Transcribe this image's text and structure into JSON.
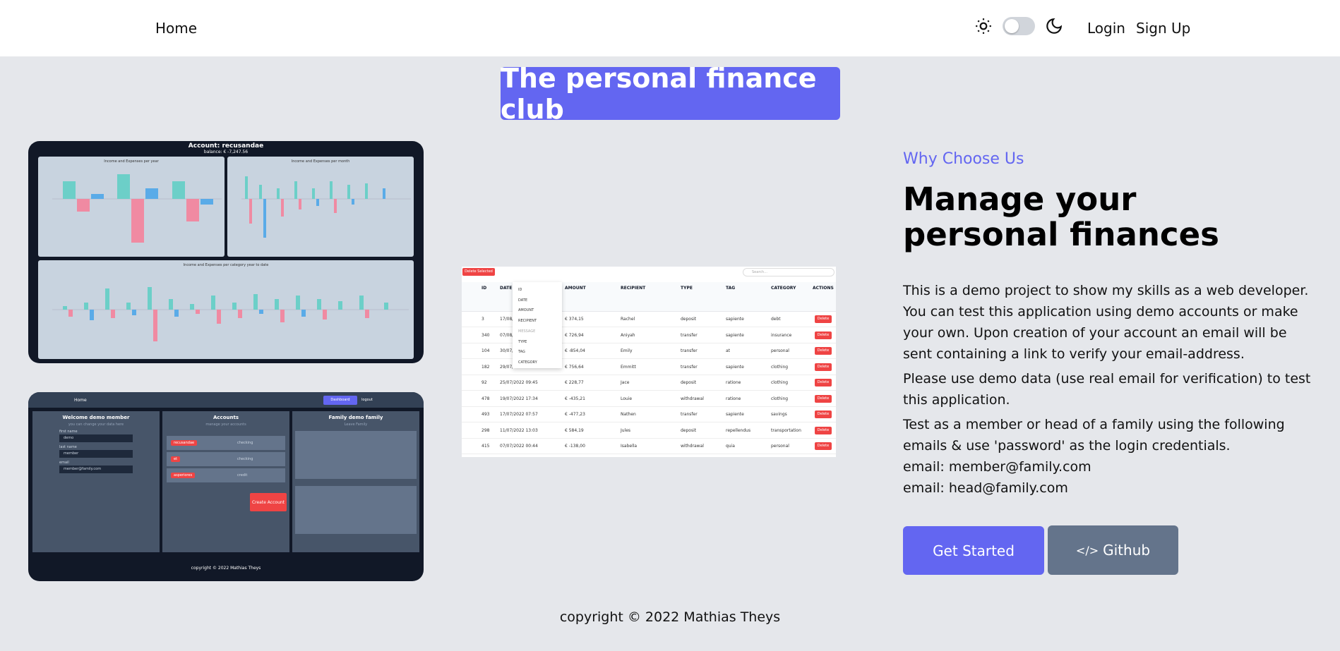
{
  "nav": {
    "home": "Home",
    "login": "Login",
    "signup": "Sign Up"
  },
  "hero": {
    "title": "The personal finance club"
  },
  "dashboard_preview": {
    "account_title": "Account: recusandae",
    "balance": "balance: € -7,247.56",
    "charts": [
      "Income and Expenses per year",
      "Income and Expenses per month",
      "Income and Expenses per category year to date"
    ]
  },
  "member_preview": {
    "nav_home": "Home",
    "dashboard_btn": "Dashboard",
    "logout": "logout",
    "welcome": "Welcome demo member",
    "welcome_sub": "you can change your data here",
    "fields": [
      {
        "label": "first name",
        "value": "demo"
      },
      {
        "label": "last name",
        "value": "member"
      },
      {
        "label": "email",
        "value": "member@family.com"
      }
    ],
    "accounts_title": "Accounts",
    "accounts_sub": "manage your accounts",
    "accounts": [
      {
        "name": "recusandae",
        "type": "checking"
      },
      {
        "name": "et",
        "type": "checking"
      },
      {
        "name": "asperiores",
        "type": "credit"
      }
    ],
    "create_account": "Create Account",
    "family_title": "Family demo family",
    "family_sub": "Leave Family",
    "copyright": "copyright © 2022 Mathias Theys"
  },
  "table_preview": {
    "delete_selected": "Delete Selected",
    "search_placeholder": "Search...",
    "headers": [
      "ID",
      "DATE",
      "AMOUNT",
      "RECIPIENT",
      "TYPE",
      "TAG",
      "CATEGORY",
      "ACTIONS"
    ],
    "menu": [
      "ID",
      "DATE",
      "AMOUNT",
      "RECIPIENT",
      "MESSAGE",
      "TYPE",
      "TAG",
      "CATEGORY"
    ],
    "rows": [
      {
        "id": "3",
        "date": "17/08/",
        "amount": "€ 374,15",
        "recipient": "Rachel",
        "type": "deposit",
        "tag": "sapiente",
        "category": "debt"
      },
      {
        "id": "340",
        "date": "07/08/",
        "amount": "€ 726,94",
        "recipient": "Aniyah",
        "type": "transfer",
        "tag": "sapiente",
        "category": "insurance"
      },
      {
        "id": "104",
        "date": "30/07/",
        "amount": "€ -854,04",
        "recipient": "Emily",
        "type": "transfer",
        "tag": "at",
        "category": "personal"
      },
      {
        "id": "182",
        "date": "29/07/2022 23:59",
        "amount": "€ 756,64",
        "recipient": "Emmitt",
        "type": "transfer",
        "tag": "sapiente",
        "category": "clothing"
      },
      {
        "id": "92",
        "date": "25/07/2022 09:45",
        "amount": "€ 228,77",
        "recipient": "Jace",
        "type": "deposit",
        "tag": "ratione",
        "category": "clothing"
      },
      {
        "id": "478",
        "date": "19/07/2022 17:34",
        "amount": "€ -435,21",
        "recipient": "Louie",
        "type": "withdrawal",
        "tag": "ratione",
        "category": "clothing"
      },
      {
        "id": "493",
        "date": "17/07/2022 07:57",
        "amount": "€ -477,23",
        "recipient": "Nathen",
        "type": "transfer",
        "tag": "sapiente",
        "category": "savings"
      },
      {
        "id": "298",
        "date": "11/07/2022 13:03",
        "amount": "€ 584,19",
        "recipient": "Jules",
        "type": "deposit",
        "tag": "repellendus",
        "category": "transportation"
      },
      {
        "id": "415",
        "date": "07/07/2022 00:44",
        "amount": "€ -138,00",
        "recipient": "Isabella",
        "type": "withdrawal",
        "tag": "quia",
        "category": "personal"
      }
    ],
    "delete_label": "Delete"
  },
  "content": {
    "why": "Why Choose Us",
    "heading": "Manage your personal finances",
    "p1": "This is a demo project to show my skills as a web developer. You can test this application using demo accounts or make your own. Upon creation of your account an email will be sent containing a link to verify your email-address.",
    "p2": "Please use demo data (use real email for verification) to test this application.",
    "p3": "Test as a member or head of a family using the following emails & use 'password' as the login credentials.",
    "email1": "email: member@family.com",
    "email2": "email: head@family.com",
    "get_started": "Get Started",
    "github": "Github"
  },
  "footer": {
    "copyright": "copyright © 2022 Mathias Theys"
  },
  "colors": {
    "accent": "#6366f1",
    "danger": "#ef4444",
    "slate": "#64748b"
  }
}
